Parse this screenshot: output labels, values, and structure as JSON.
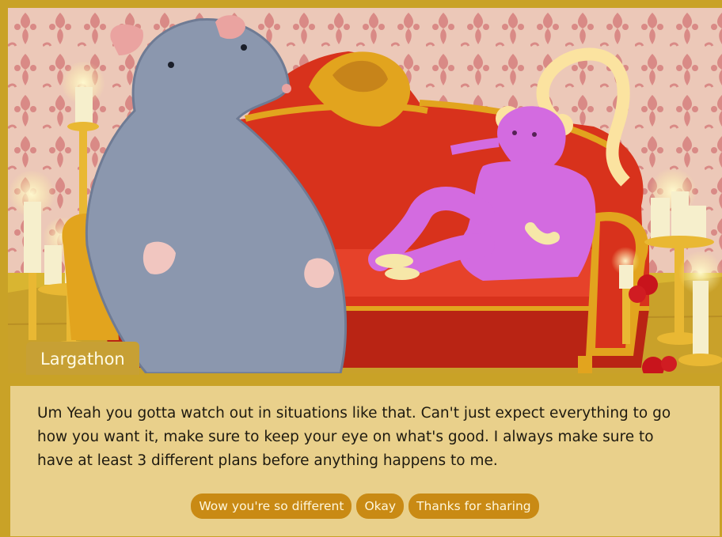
{
  "speaker": {
    "name": "Largathon"
  },
  "dialog": {
    "text": "Um Yeah you gotta watch out in situations like that. Can't just expect everything to go how you want it, make sure to keep your eye on what's good. I always make sure to have at least 3 different plans before anything happens to me."
  },
  "choices": [
    {
      "label": "Wow you're so different"
    },
    {
      "label": "Okay"
    },
    {
      "label": "Thanks for sharing"
    }
  ],
  "colors": {
    "frame": "#c9a227",
    "dialog_bg": "#e9d08b",
    "choice_bg": "#c98a14",
    "name_tag_bg": "#c7a034",
    "wallpaper": "#e8c2b4",
    "sofa_red": "#d8321c",
    "sofa_gold": "#e2a41e",
    "grey_rat": "#8b97ae",
    "pink_rat": "#d36be0"
  }
}
